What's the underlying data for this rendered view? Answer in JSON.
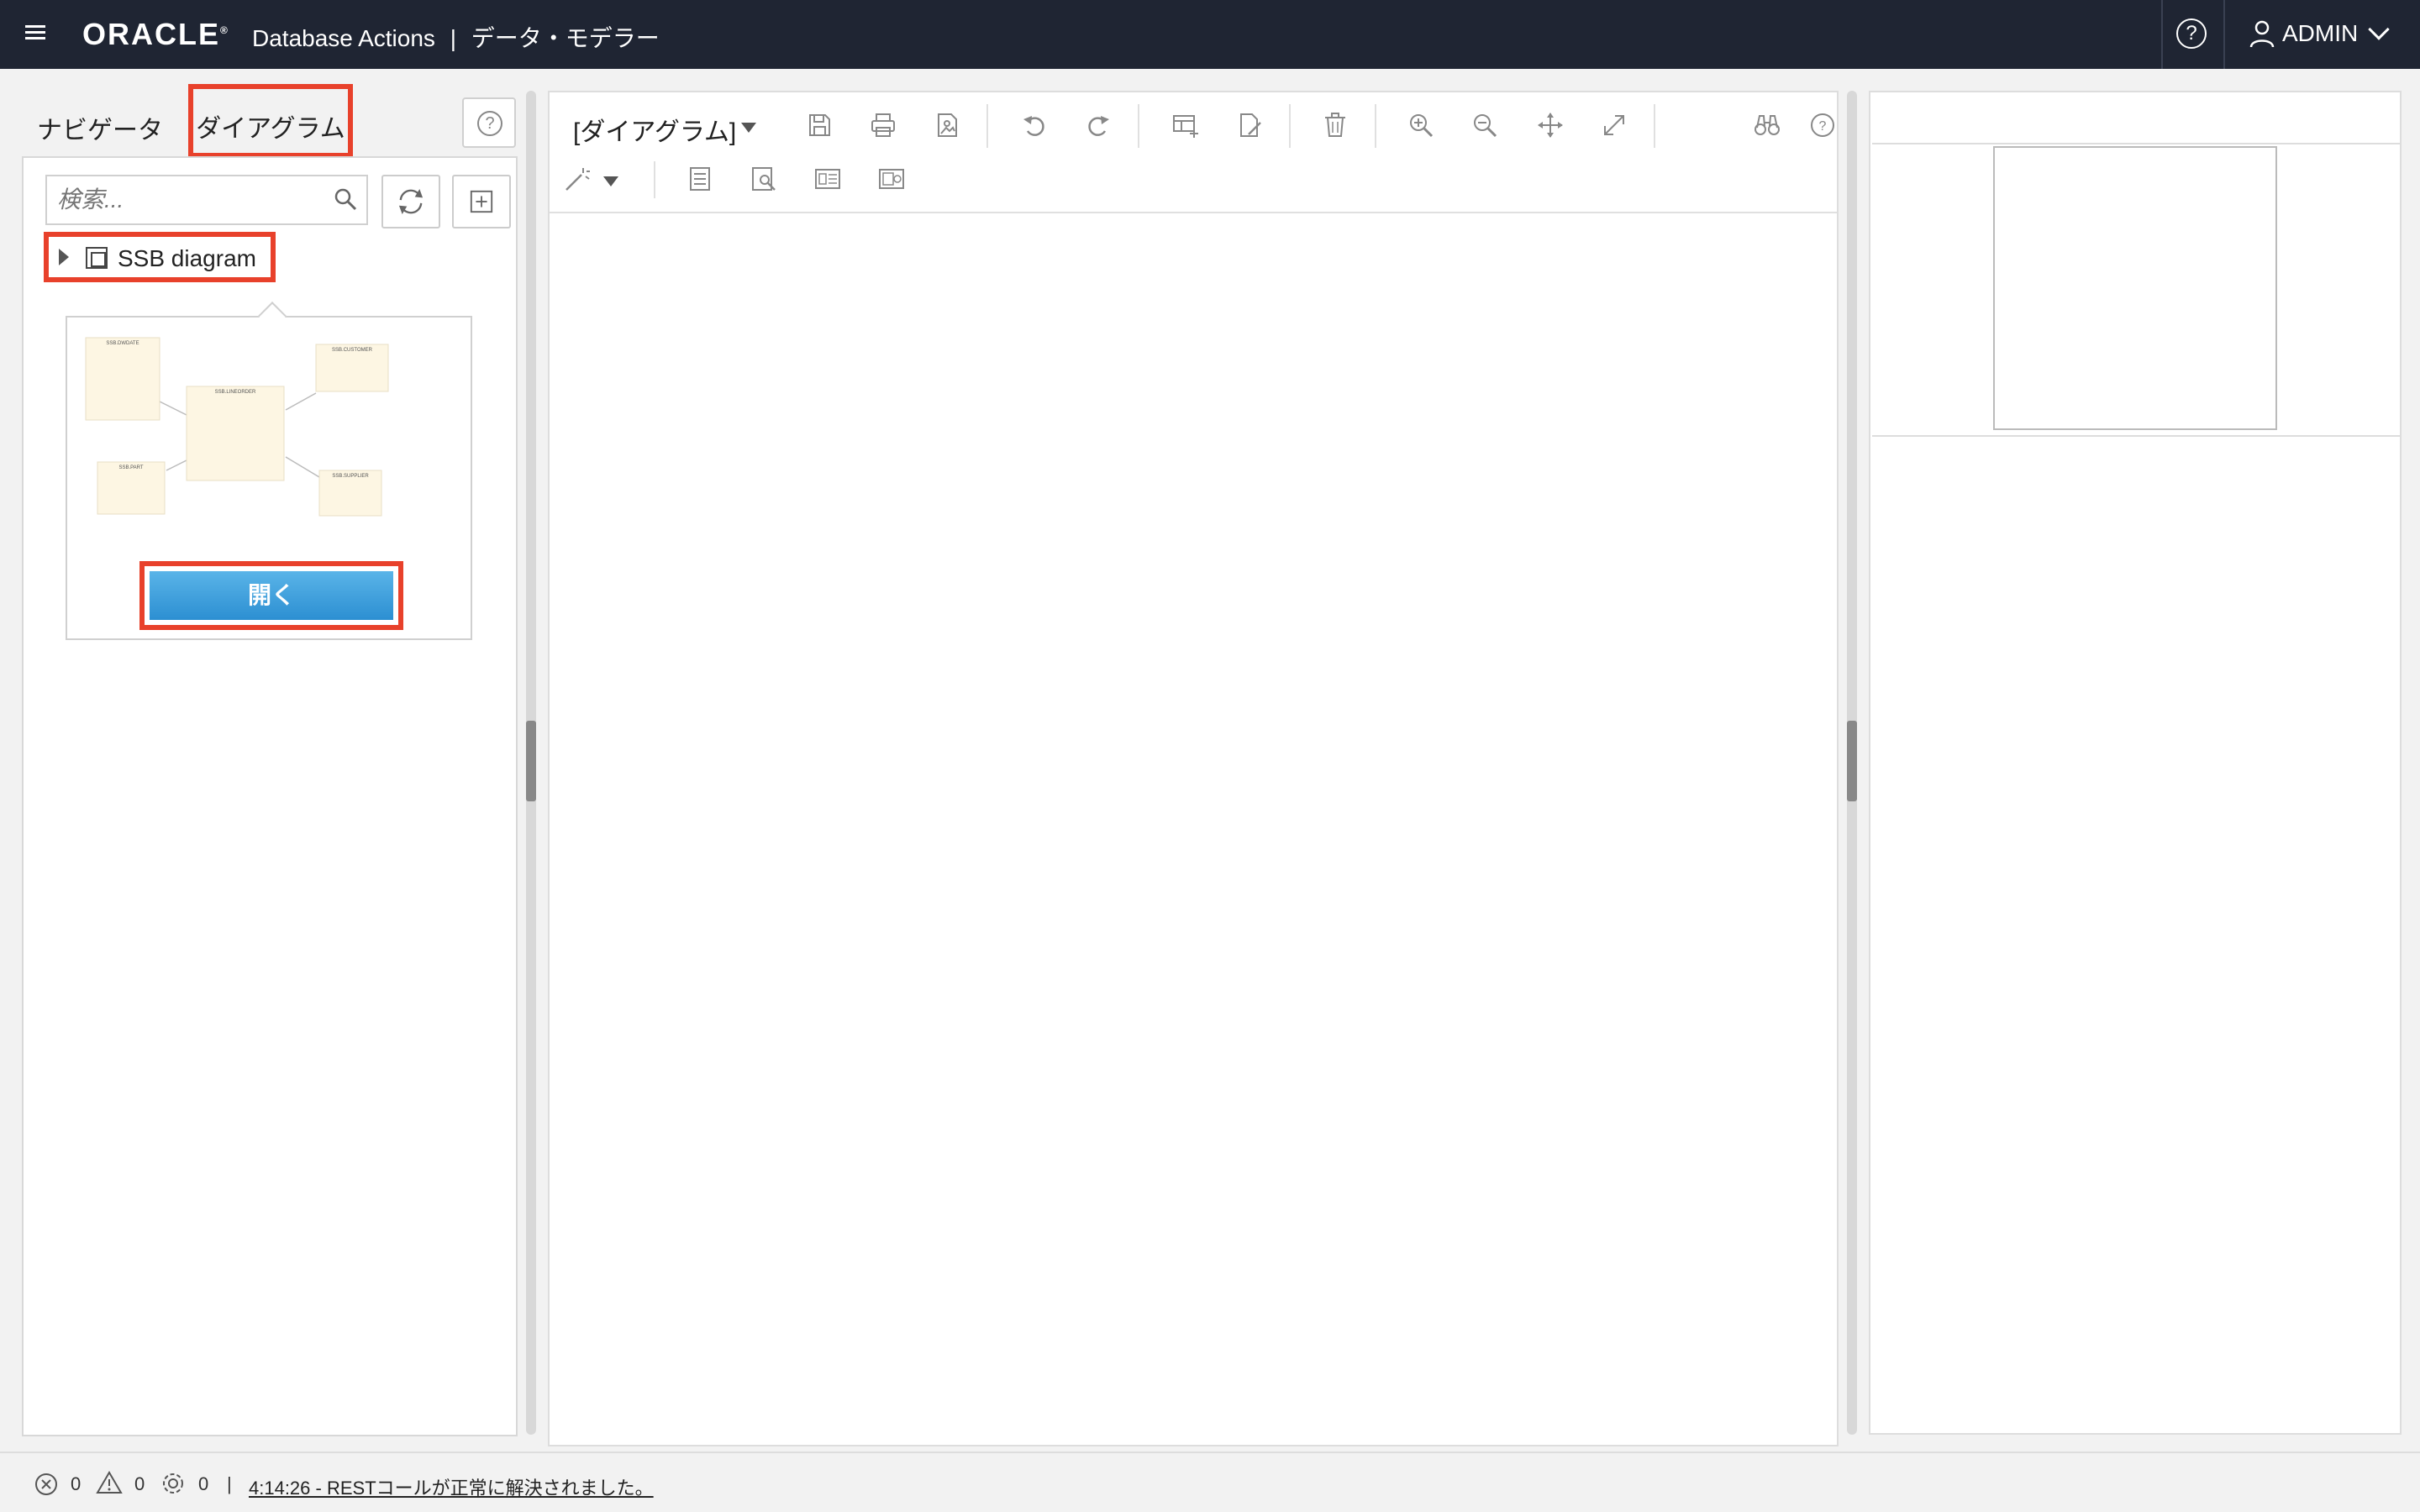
{
  "header": {
    "logo": "ORACLE",
    "app_name": "Database Actions",
    "separator": "|",
    "page_title": "データ・モデラー",
    "user": "ADMIN"
  },
  "left": {
    "tabs": [
      "ナビゲータ",
      "ダイアグラム"
    ],
    "search_placeholder": "検索...",
    "tree_item": "SSB diagram",
    "open_button": "開く",
    "preview_tables": [
      "SSB.DWDATE",
      "SSB.CUSTOMER",
      "SSB.LINEORDER",
      "SSB.PART",
      "SSB.SUPPLIER"
    ]
  },
  "toolbar": {
    "diagram_selector": "[ダイアグラム]"
  },
  "status": {
    "errors": "0",
    "warnings": "0",
    "tasks": "0",
    "separator": "|",
    "message": "4:14:26 - RESTコールが正常に解決されました。"
  },
  "colors": {
    "header_bg": "#1f2533",
    "highlight": "#e8412b",
    "open_button": "#3a9fe0",
    "table_fill": "#fdf6e3"
  }
}
